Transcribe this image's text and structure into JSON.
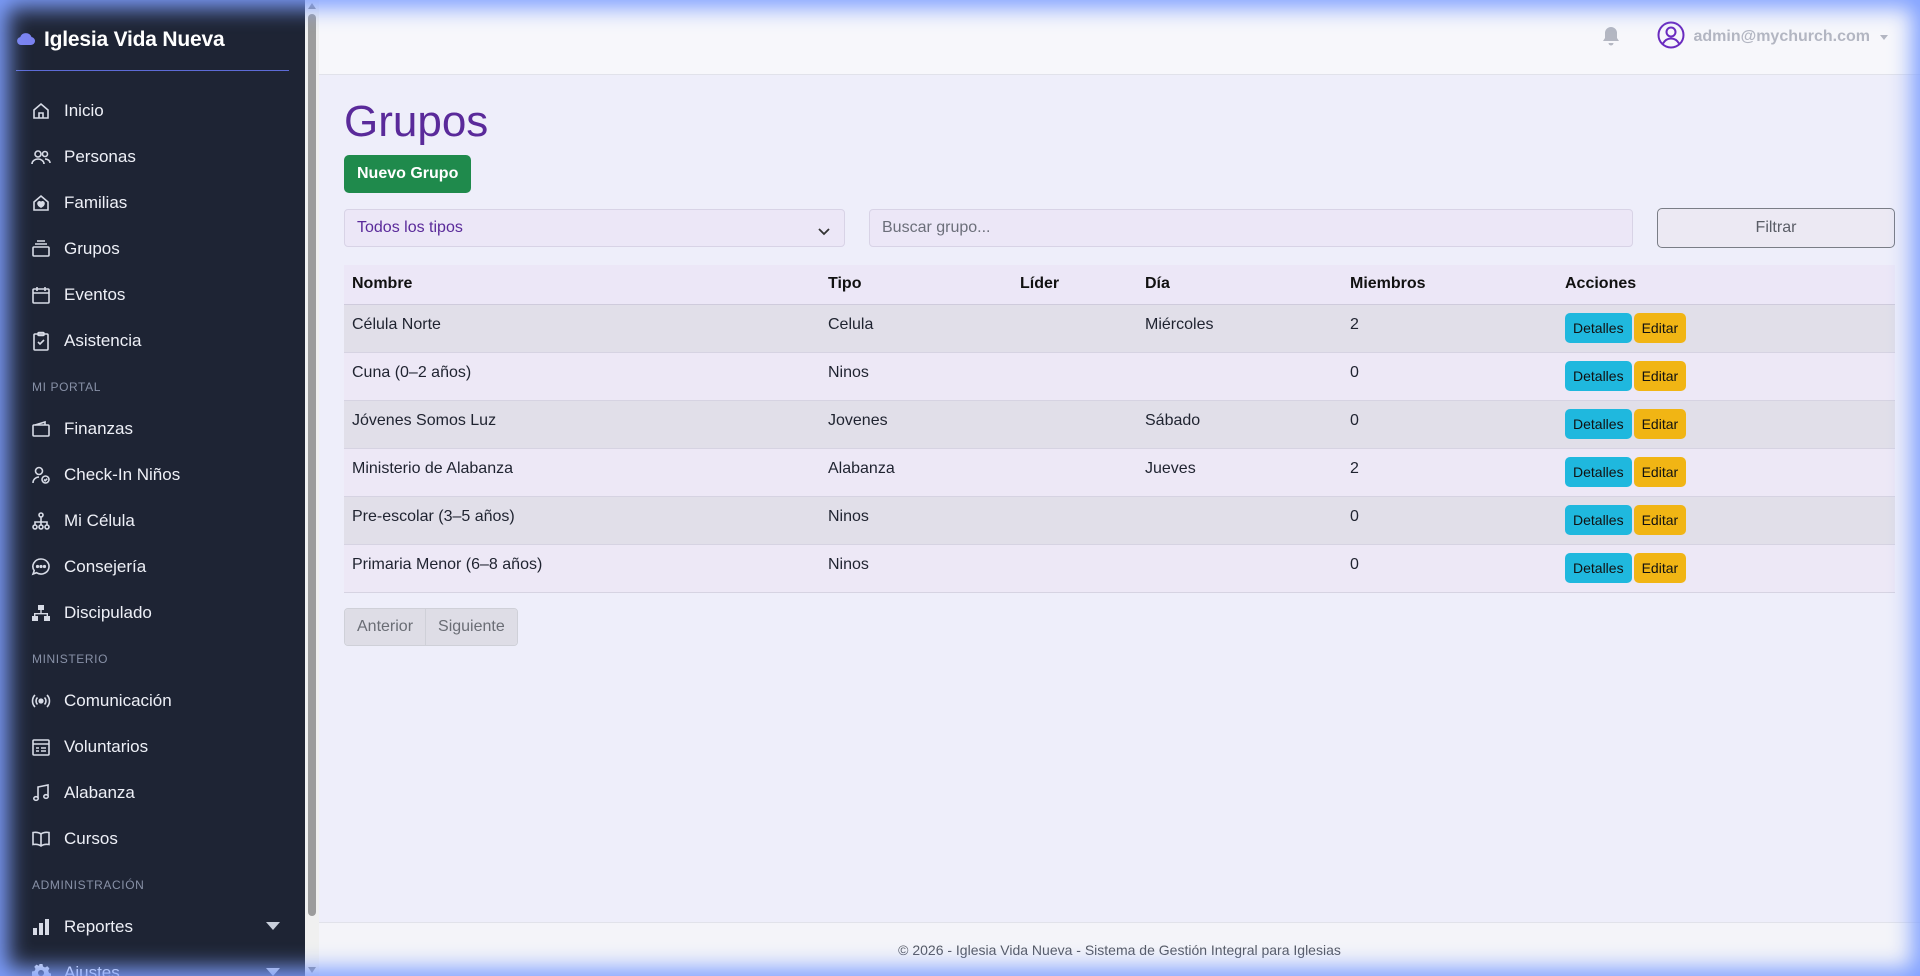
{
  "brand": {
    "name": "Iglesia Vida Nueva",
    "icon": "cloud-icon"
  },
  "sidebar": {
    "items": [
      {
        "label": "Inicio",
        "icon": "home-icon"
      },
      {
        "label": "Personas",
        "icon": "users-icon"
      },
      {
        "label": "Familias",
        "icon": "family-home-icon"
      },
      {
        "label": "Grupos",
        "icon": "stack-icon"
      },
      {
        "label": "Eventos",
        "icon": "calendar-icon"
      },
      {
        "label": "Asistencia",
        "icon": "clipboard-check-icon"
      }
    ],
    "section_portal": "MI PORTAL",
    "portal_items": [
      {
        "label": "Finanzas",
        "icon": "wallet-icon"
      },
      {
        "label": "Check-In Niños",
        "icon": "user-check-icon"
      },
      {
        "label": "Mi Célula",
        "icon": "hierarchy-icon"
      },
      {
        "label": "Consejería",
        "icon": "chat-icon"
      },
      {
        "label": "Discipulado",
        "icon": "diagram-icon"
      }
    ],
    "section_ministerio": "MINISTERIO",
    "ministerio_items": [
      {
        "label": "Comunicación",
        "icon": "broadcast-icon"
      },
      {
        "label": "Voluntarios",
        "icon": "calendar-list-icon"
      },
      {
        "label": "Alabanza",
        "icon": "music-note-icon"
      },
      {
        "label": "Cursos",
        "icon": "book-icon"
      }
    ],
    "section_admin": "ADMINISTRACIÓN",
    "admin_items": [
      {
        "label": "Reportes",
        "icon": "bar-chart-icon"
      },
      {
        "label": "Ajustes",
        "icon": "gear-icon"
      }
    ]
  },
  "topbar": {
    "user": "admin@mychurch.com"
  },
  "main": {
    "title": "Grupos",
    "new_button": "Nuevo Grupo",
    "type_select": "Todos los tipos",
    "search_placeholder": "Buscar grupo...",
    "filter_button": "Filtrar",
    "columns": [
      "Nombre",
      "Tipo",
      "Líder",
      "Día",
      "Miembros",
      "Acciones"
    ],
    "rows": [
      {
        "nombre": "Célula Norte",
        "tipo": "Celula",
        "lider": "",
        "dia": "Miércoles",
        "miembros": "2"
      },
      {
        "nombre": "Cuna (0–2 años)",
        "tipo": "Ninos",
        "lider": "",
        "dia": "",
        "miembros": "0"
      },
      {
        "nombre": "Jóvenes Somos Luz",
        "tipo": "Jovenes",
        "lider": "",
        "dia": "Sábado",
        "miembros": "0"
      },
      {
        "nombre": "Ministerio de Alabanza",
        "tipo": "Alabanza",
        "lider": "",
        "dia": "Jueves",
        "miembros": "2"
      },
      {
        "nombre": "Pre-escolar (3–5 años)",
        "tipo": "Ninos",
        "lider": "",
        "dia": "",
        "miembros": "0"
      },
      {
        "nombre": "Primaria Menor (6–8 años)",
        "tipo": "Ninos",
        "lider": "",
        "dia": "",
        "miembros": "0"
      }
    ],
    "details_label": "Detalles",
    "edit_label": "Editar",
    "prev_label": "Anterior",
    "next_label": "Siguiente"
  },
  "footer": {
    "text": "© 2026 - Iglesia Vida Nueva - Sistema de Gestión Integral para Iglesias"
  },
  "colors": {
    "sidebar_bg": "#1e2434",
    "title_purple": "#5a2a9a",
    "success": "#1f8a4c",
    "info": "#1fb8de",
    "warning": "#f1b514"
  }
}
